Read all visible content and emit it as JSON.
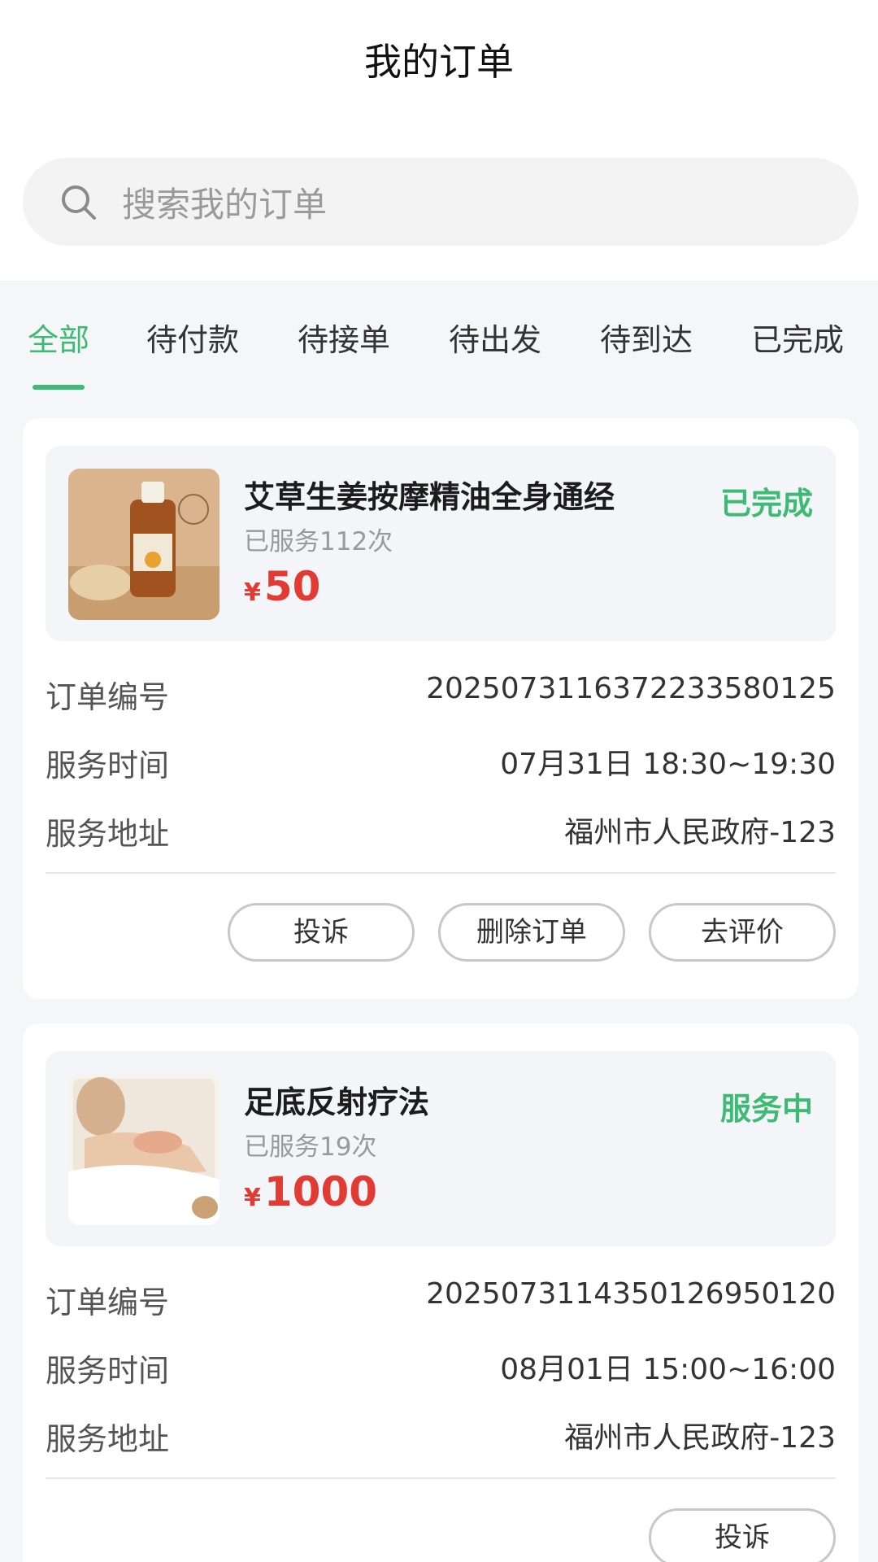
{
  "header": {
    "title": "我的订单"
  },
  "search": {
    "placeholder": "搜索我的订单",
    "icon": "search-icon"
  },
  "tabs": [
    {
      "label": "全部",
      "active": true
    },
    {
      "label": "待付款",
      "active": false
    },
    {
      "label": "待接单",
      "active": false
    },
    {
      "label": "待出发",
      "active": false
    },
    {
      "label": "待到达",
      "active": false
    },
    {
      "label": "已完成",
      "active": false
    }
  ],
  "colors": {
    "accent": "#3dbb74",
    "price": "#e23b33"
  },
  "orders": [
    {
      "title": "艾草生姜按摩精油全身通经",
      "served": "已服务112次",
      "currency": "¥",
      "price": "50",
      "status": "已完成",
      "labels": {
        "order_no": "订单编号",
        "time": "服务时间",
        "address": "服务地址"
      },
      "order_no": "202507311637223358012 5",
      "time": "07月31日 18:30~19:30",
      "address": "福州市人民政府-123",
      "buttons": [
        "投诉",
        "删除订单",
        "去评价"
      ]
    },
    {
      "title": "足底反射疗法",
      "served": "已服务19次",
      "currency": "¥",
      "price": "1000",
      "status": "服务中",
      "labels": {
        "order_no": "订单编号",
        "time": "服务时间",
        "address": "服务地址"
      },
      "order_no": "2025073114350126950120",
      "time": "08月01日 15:00~16:00",
      "address": "福州市人民政府-123",
      "buttons": [
        "投诉"
      ]
    }
  ]
}
